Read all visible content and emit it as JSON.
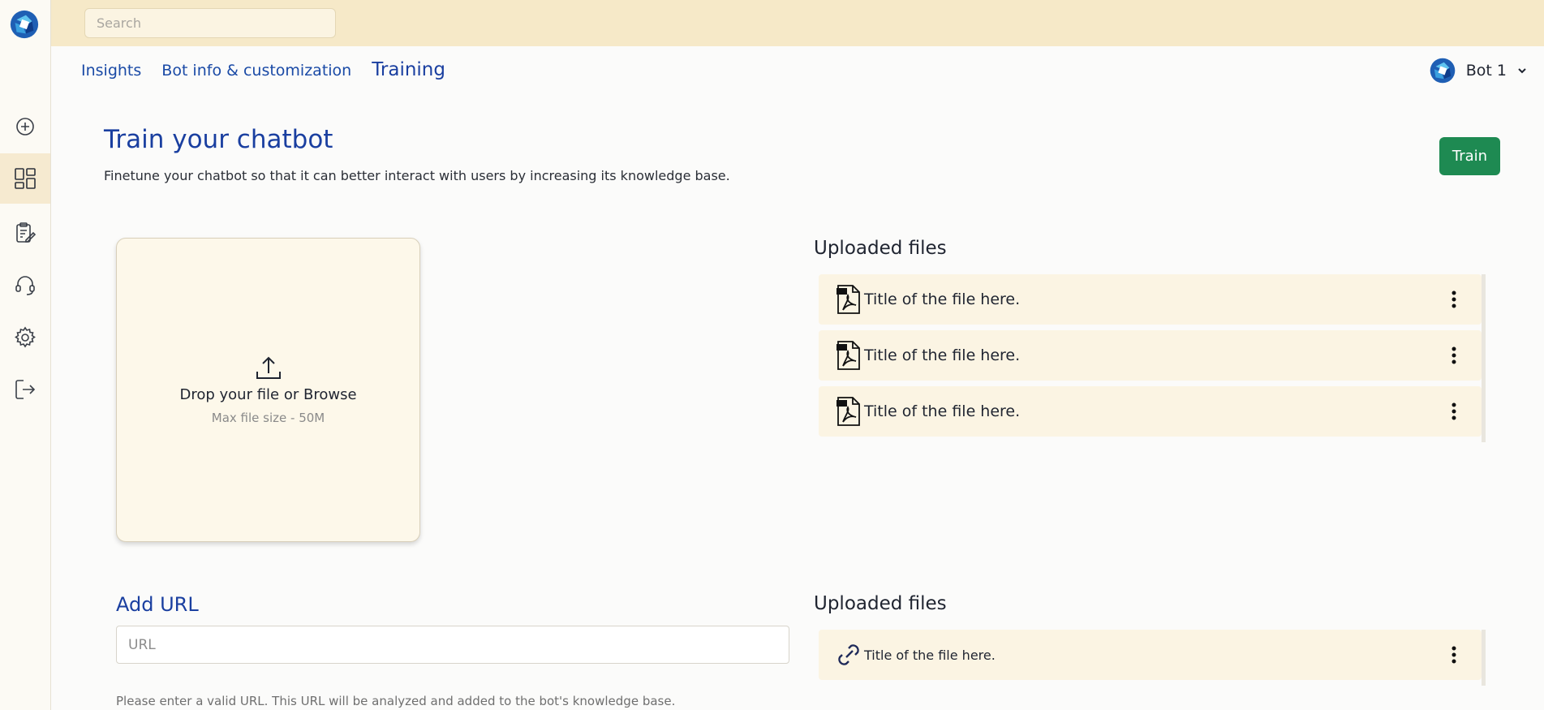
{
  "search": {
    "placeholder": "Search"
  },
  "nav": {
    "items": [
      {
        "label": "Insights"
      },
      {
        "label": "Bot info & customization"
      },
      {
        "label": "Training"
      }
    ],
    "bot_name": "Bot 1"
  },
  "sidebar": {
    "items": [
      {
        "icon": "add-circle-icon"
      },
      {
        "icon": "dashboard-icon",
        "active": true
      },
      {
        "icon": "clipboard-edit-icon"
      },
      {
        "icon": "headset-icon"
      },
      {
        "icon": "gear-icon"
      },
      {
        "icon": "logout-icon"
      }
    ]
  },
  "page": {
    "title": "Train your chatbot",
    "subtitle": "Finetune your chatbot so that it can better interact with users by increasing its knowledge base.",
    "train_label": "Train"
  },
  "dropzone": {
    "label": "Drop your file or Browse",
    "sublabel": "Max file size - 50M"
  },
  "uploaded_files": {
    "title": "Uploaded files",
    "files": [
      {
        "title": "Title of the file here.",
        "icon": "pdf-icon"
      },
      {
        "title": "Title of the file here.",
        "icon": "pdf-icon"
      },
      {
        "title": "Title of the file here.",
        "icon": "pdf-icon"
      }
    ]
  },
  "url_section": {
    "title": "Add URL",
    "placeholder": "URL",
    "help": "Please enter a valid URL. This URL will be analyzed and added to the bot's knowledge base."
  },
  "uploaded_urls": {
    "title": "Uploaded files",
    "files": [
      {
        "title": "Title of the file here.",
        "icon": "link-icon"
      }
    ]
  },
  "colors": {
    "accent_blue": "#1a3fa0",
    "train_green": "#1e8a52",
    "topbar": "#f6e9c8"
  }
}
